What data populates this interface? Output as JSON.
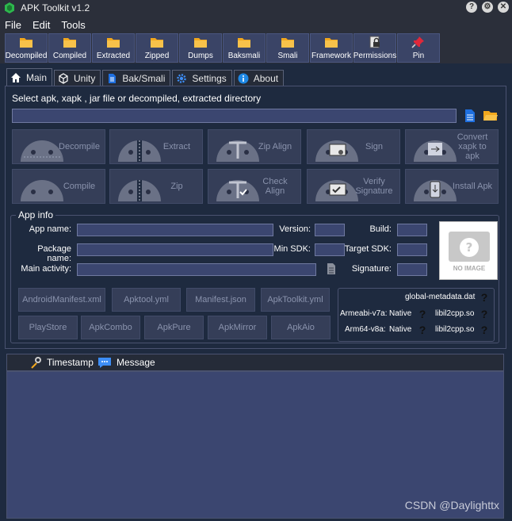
{
  "window": {
    "title": "APK Toolkit v1.2",
    "controls": [
      "?",
      "⚙",
      "✕"
    ]
  },
  "menu": [
    "File",
    "Edit",
    "Tools"
  ],
  "toolbar": [
    {
      "label": "Decompiled",
      "icon": "folder-icon"
    },
    {
      "label": "Compiled",
      "icon": "folder-icon"
    },
    {
      "label": "Extracted",
      "icon": "folder-icon"
    },
    {
      "label": "Zipped",
      "icon": "folder-icon"
    },
    {
      "label": "Dumps",
      "icon": "folder-icon"
    },
    {
      "label": "Baksmali",
      "icon": "folder-icon"
    },
    {
      "label": "Smali",
      "icon": "folder-icon"
    },
    {
      "label": "Framework",
      "icon": "folder-icon"
    },
    {
      "label": "Permissions",
      "icon": "lock-file-icon"
    },
    {
      "label": "Pin",
      "icon": "pin-icon"
    }
  ],
  "tabs": [
    {
      "label": "Main",
      "icon": "home-icon",
      "active": true
    },
    {
      "label": "Unity",
      "icon": "unity-icon"
    },
    {
      "label": "Bak/Smali",
      "icon": "document-icon"
    },
    {
      "label": "Settings",
      "icon": "gear-icon"
    },
    {
      "label": "About",
      "icon": "info-icon"
    }
  ],
  "main": {
    "prompt": "Select apk, xapk , jar file or decompiled, extracted directory",
    "path_value": "",
    "actions_row1": [
      "Decompile",
      "Extract",
      "Zip Align",
      "Sign",
      "Convert xapk to apk"
    ],
    "actions_row2": [
      "Compile",
      "Zip",
      "Check Align",
      "Verify Signature",
      "Install Apk"
    ],
    "app_info": {
      "title": "App info",
      "app_name_label": "App name:",
      "package_name_label": "Package name:",
      "main_activity_label": "Main activity:",
      "version_label": "Version:",
      "min_sdk_label": "Min SDK:",
      "signature_label": "Signature:",
      "build_label": "Build:",
      "target_sdk_label": "Target SDK:",
      "no_image_text": "NO IMAGE",
      "file_buttons_row1": [
        "AndroidManifest.xml",
        "Apktool.yml",
        "Manifest.json",
        "ApkToolkit.yml"
      ],
      "file_buttons_row2": [
        "PlayStore",
        "ApkCombo",
        "ApkPure",
        "ApkMirror",
        "ApkAio"
      ],
      "meta": {
        "global_metadata": "global-metadata.dat",
        "armeabi_label": "Armeabi-v7a:",
        "armeabi_type": "Native",
        "armeabi_lib": "libil2cpp.so",
        "arm64_label": "Arm64-v8a:",
        "arm64_type": "Native",
        "arm64_lib": "libil2cpp.so",
        "unknown_mark": "?"
      }
    }
  },
  "log": {
    "timestamp_header": "Timestamp",
    "message_header": "Message"
  },
  "watermark": "CSDN @Daylighttx",
  "colors": {
    "panel_bg": "#1e2a3f",
    "input_bg": "#3b4670",
    "button_bg": "#353e58",
    "folder": "#f2a81d",
    "pin": "#e0283a"
  }
}
